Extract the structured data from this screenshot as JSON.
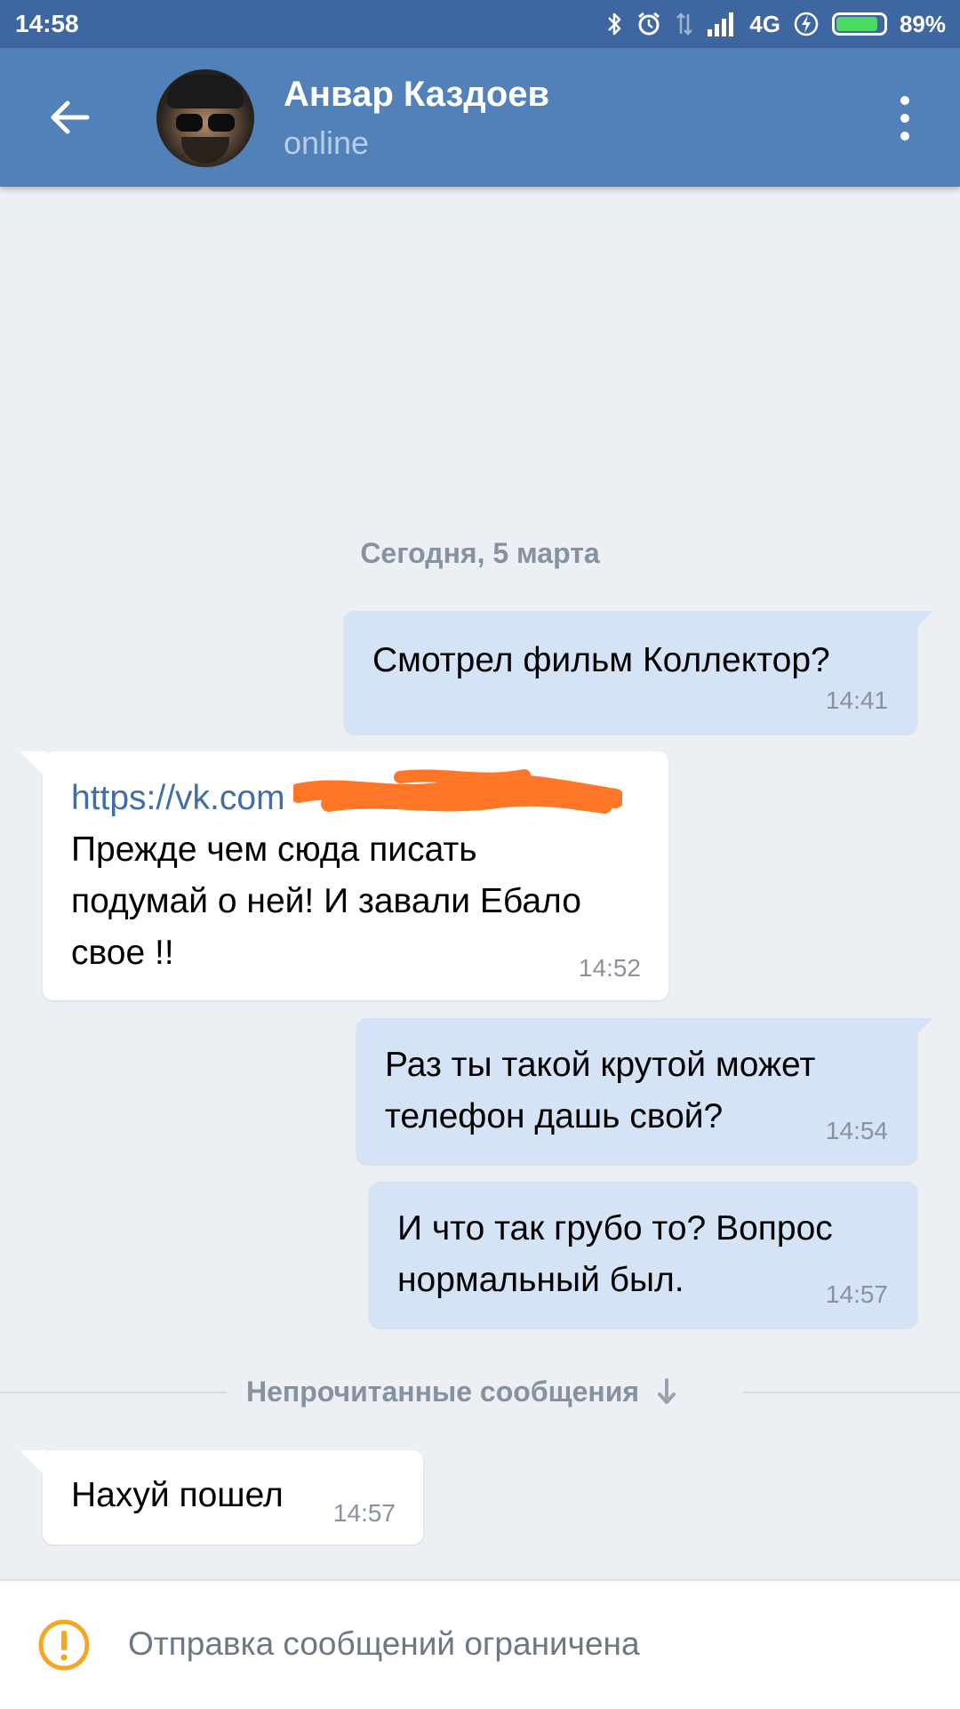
{
  "status_bar": {
    "time": "14:58",
    "network": "4G",
    "battery_percent": "89%",
    "battery_level": 0.89,
    "icons": [
      "bluetooth-icon",
      "alarm-icon",
      "data-arrows-icon",
      "signal-icon",
      "charging-icon",
      "battery-icon"
    ]
  },
  "header": {
    "name": "Анвар Каздоев",
    "status": "online",
    "back_icon": "arrow-left-icon",
    "menu_icon": "more-vertical-icon"
  },
  "chat": {
    "date_separator": "Сегодня, 5 марта",
    "messages": [
      {
        "direction": "out",
        "lines": [
          "Смотрел фильм Коллектор?"
        ],
        "time": "14:41"
      },
      {
        "direction": "in",
        "link": "https://vk.com",
        "lines": [
          "Прежде чем сюда писать",
          "подумай о ней! И завали Ебало",
          "свое !!"
        ],
        "time": "14:52"
      },
      {
        "direction": "out",
        "lines": [
          "Раз ты такой крутой может",
          "телефон дашь свой?"
        ],
        "time": "14:54"
      },
      {
        "direction": "out",
        "lines": [
          "И что так грубо то? Вопрос",
          "нормальный был."
        ],
        "time": "14:57"
      },
      {
        "direction": "in",
        "lines": [
          "Нахуй пошел"
        ],
        "time": "14:57"
      }
    ],
    "unread_separator": "Непрочитанные сообщения"
  },
  "bottom_bar": {
    "notice": "Отправка сообщений ограничена",
    "icon": "warning-icon"
  },
  "colors": {
    "status_bar": "#3e66a0",
    "header": "#5181b8",
    "background": "#eceff3",
    "outgoing_bubble": "#d4e3f5",
    "incoming_bubble": "#ffffff",
    "link": "#3f6ea8",
    "redaction": "#ff7626",
    "warning": "#f5a623"
  }
}
